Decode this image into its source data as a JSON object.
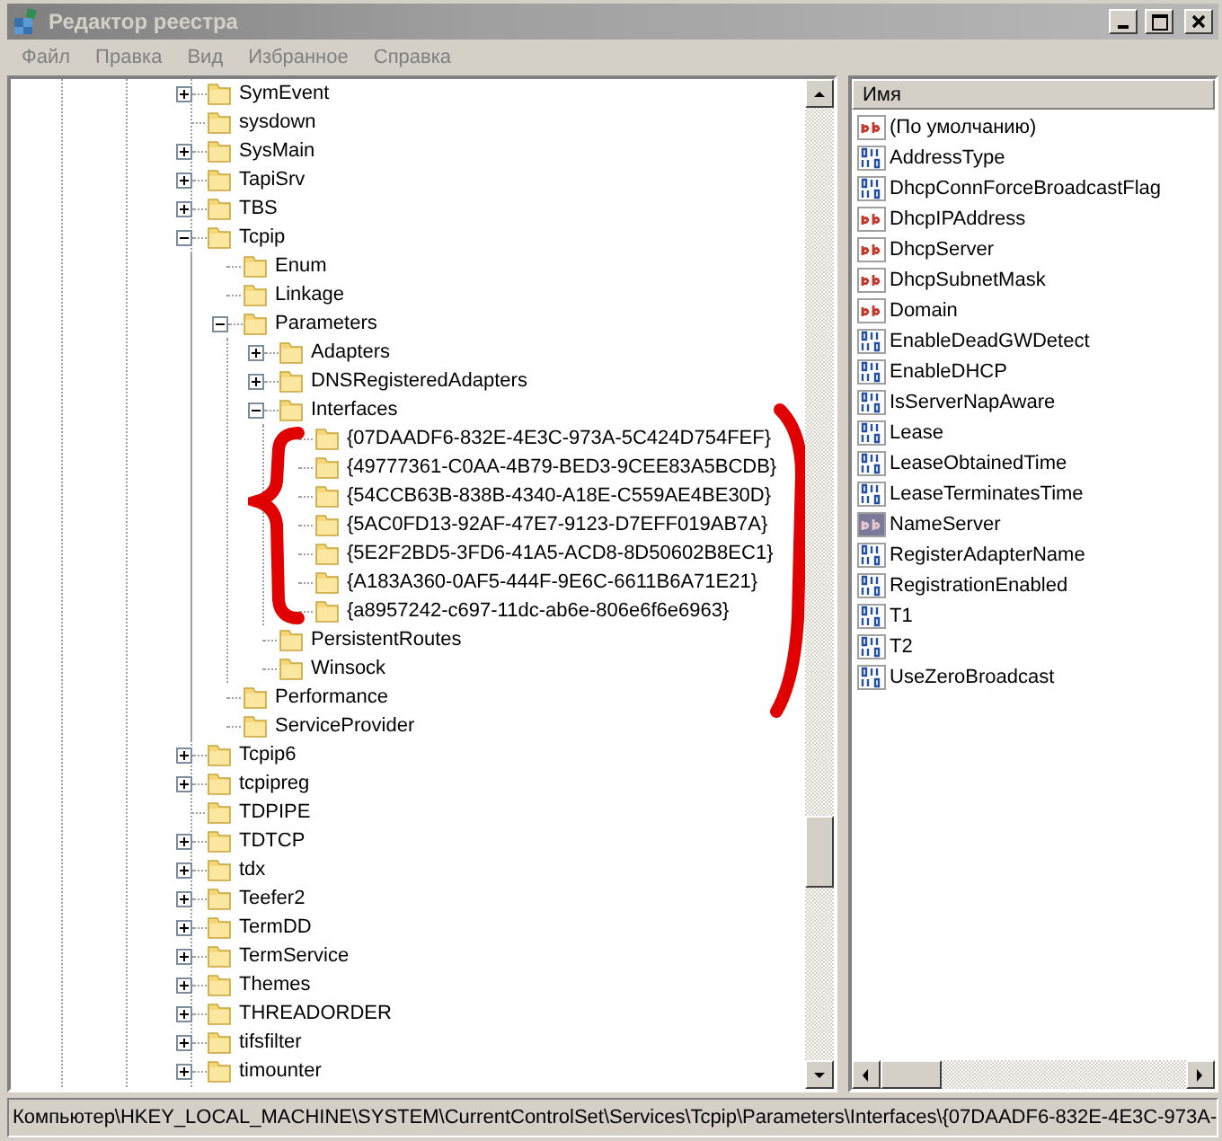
{
  "window": {
    "title": "Редактор реестра"
  },
  "menu": [
    "Файл",
    "Правка",
    "Вид",
    "Избранное",
    "Справка"
  ],
  "tree": {
    "nodes": [
      {
        "label": "SymEvent",
        "expandable": true,
        "expanded": false
      },
      {
        "label": "sysdown",
        "expandable": false
      },
      {
        "label": "SysMain",
        "expandable": true,
        "expanded": false
      },
      {
        "label": "TapiSrv",
        "expandable": true,
        "expanded": false
      },
      {
        "label": "TBS",
        "expandable": true,
        "expanded": false
      },
      {
        "label": "Tcpip",
        "expandable": true,
        "expanded": true,
        "children": [
          {
            "label": "Enum",
            "expandable": false
          },
          {
            "label": "Linkage",
            "expandable": false
          },
          {
            "label": "Parameters",
            "expandable": true,
            "expanded": true,
            "children": [
              {
                "label": "Adapters",
                "expandable": true,
                "expanded": false
              },
              {
                "label": "DNSRegisteredAdapters",
                "expandable": true,
                "expanded": false
              },
              {
                "label": "Interfaces",
                "expandable": true,
                "expanded": true,
                "children": [
                  {
                    "label": "{07DAADF6-832E-4E3C-973A-5C424D754FEF}",
                    "expandable": false
                  },
                  {
                    "label": "{49777361-C0AA-4B79-BED3-9CEE83A5BCDB}",
                    "expandable": false
                  },
                  {
                    "label": "{54CCB63B-838B-4340-A18E-C559AE4BE30D}",
                    "expandable": false
                  },
                  {
                    "label": "{5AC0FD13-92AF-47E7-9123-D7EFF019AB7A}",
                    "expandable": false
                  },
                  {
                    "label": "{5E2F2BD5-3FD6-41A5-ACD8-8D50602B8EC1}",
                    "expandable": false
                  },
                  {
                    "label": "{A183A360-0AF5-444F-9E6C-6611B6A71E21}",
                    "expandable": false
                  },
                  {
                    "label": "{a8957242-c697-11dc-ab6e-806e6f6e6963}",
                    "expandable": false
                  }
                ]
              },
              {
                "label": "PersistentRoutes",
                "expandable": false
              },
              {
                "label": "Winsock",
                "expandable": false
              }
            ]
          },
          {
            "label": "Performance",
            "expandable": false
          },
          {
            "label": "ServiceProvider",
            "expandable": false
          }
        ]
      },
      {
        "label": "Tcpip6",
        "expandable": true,
        "expanded": false
      },
      {
        "label": "tcpipreg",
        "expandable": true,
        "expanded": false
      },
      {
        "label": "TDPIPE",
        "expandable": false
      },
      {
        "label": "TDTCP",
        "expandable": true,
        "expanded": false
      },
      {
        "label": "tdx",
        "expandable": true,
        "expanded": false
      },
      {
        "label": "Teefer2",
        "expandable": true,
        "expanded": false
      },
      {
        "label": "TermDD",
        "expandable": true,
        "expanded": false
      },
      {
        "label": "TermService",
        "expandable": true,
        "expanded": false
      },
      {
        "label": "Themes",
        "expandable": true,
        "expanded": false
      },
      {
        "label": "THREADORDER",
        "expandable": true,
        "expanded": false
      },
      {
        "label": "tifsfilter",
        "expandable": true,
        "expanded": false
      },
      {
        "label": "timounter",
        "expandable": true,
        "expanded": false
      }
    ]
  },
  "values": {
    "column": "Имя",
    "items": [
      {
        "name": "(По умолчанию)",
        "kind": "string",
        "selected": false
      },
      {
        "name": "AddressType",
        "kind": "binary",
        "selected": false
      },
      {
        "name": "DhcpConnForceBroadcastFlag",
        "kind": "binary",
        "selected": false
      },
      {
        "name": "DhcpIPAddress",
        "kind": "string",
        "selected": false
      },
      {
        "name": "DhcpServer",
        "kind": "string",
        "selected": false
      },
      {
        "name": "DhcpSubnetMask",
        "kind": "string",
        "selected": false
      },
      {
        "name": "Domain",
        "kind": "string",
        "selected": false
      },
      {
        "name": "EnableDeadGWDetect",
        "kind": "binary",
        "selected": false
      },
      {
        "name": "EnableDHCP",
        "kind": "binary",
        "selected": false
      },
      {
        "name": "IsServerNapAware",
        "kind": "binary",
        "selected": false
      },
      {
        "name": "Lease",
        "kind": "binary",
        "selected": false
      },
      {
        "name": "LeaseObtainedTime",
        "kind": "binary",
        "selected": false
      },
      {
        "name": "LeaseTerminatesTime",
        "kind": "binary",
        "selected": false
      },
      {
        "name": "NameServer",
        "kind": "string",
        "selected": true
      },
      {
        "name": "RegisterAdapterName",
        "kind": "binary",
        "selected": false
      },
      {
        "name": "RegistrationEnabled",
        "kind": "binary",
        "selected": false
      },
      {
        "name": "T1",
        "kind": "binary",
        "selected": false
      },
      {
        "name": "T2",
        "kind": "binary",
        "selected": false
      },
      {
        "name": "UseZeroBroadcast",
        "kind": "binary",
        "selected": false
      }
    ]
  },
  "status_bar": "Компьютер\\HKEY_LOCAL_MACHINE\\SYSTEM\\CurrentControlSet\\Services\\Tcpip\\Parameters\\Interfaces\\{07DAADF6-832E-4E3C-973A-"
}
